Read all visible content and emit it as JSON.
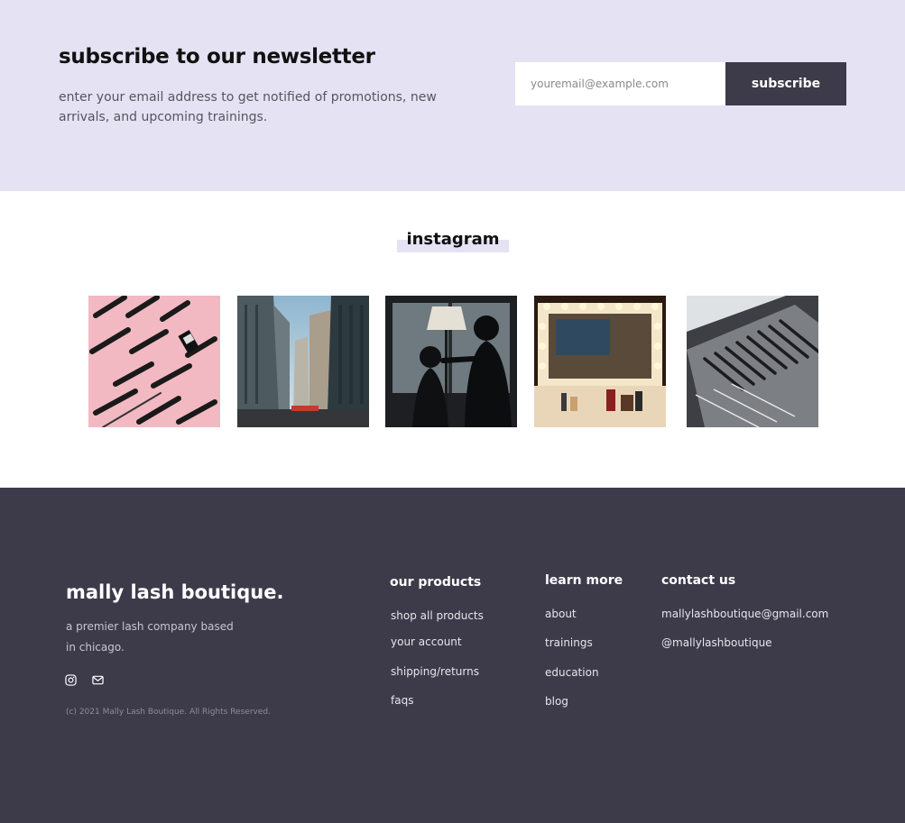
{
  "newsletter": {
    "title": "subscribe to our newsletter",
    "description": "enter your email address to get notified of promotions, new arrivals, and upcoming trainings.",
    "email_placeholder": "youremail@example.com",
    "subscribe_label": "subscribe",
    "background_color": "#e5e2f3"
  },
  "instagram": {
    "title": "instagram",
    "photos": [
      {
        "name": "pink-lash-tools-photo"
      },
      {
        "name": "city-street-photo"
      },
      {
        "name": "makeup-artist-silhouette-photo"
      },
      {
        "name": "vanity-mirror-photo"
      },
      {
        "name": "lash-brushes-photo"
      }
    ]
  },
  "footer": {
    "background_color": "#3d3b4a",
    "brand_name": "mally lash boutique.",
    "tagline_line1": "a premier lash company based",
    "tagline_line2": "in chicago.",
    "social_icons": [
      "instagram-icon",
      "email-icon"
    ],
    "copyright": "(c) 2021 Mally Lash Boutique. All Rights Reserved.",
    "columns": {
      "products": {
        "title": "our products",
        "links": [
          "shop all products",
          "your account",
          "shipping/returns",
          "faqs"
        ]
      },
      "learn": {
        "title": "learn more",
        "links": [
          "about",
          "trainings",
          "education",
          "blog"
        ]
      },
      "contact": {
        "title": "contact us",
        "links": [
          "mallylashboutique@gmail.com",
          "@mallylashboutique"
        ]
      }
    }
  }
}
